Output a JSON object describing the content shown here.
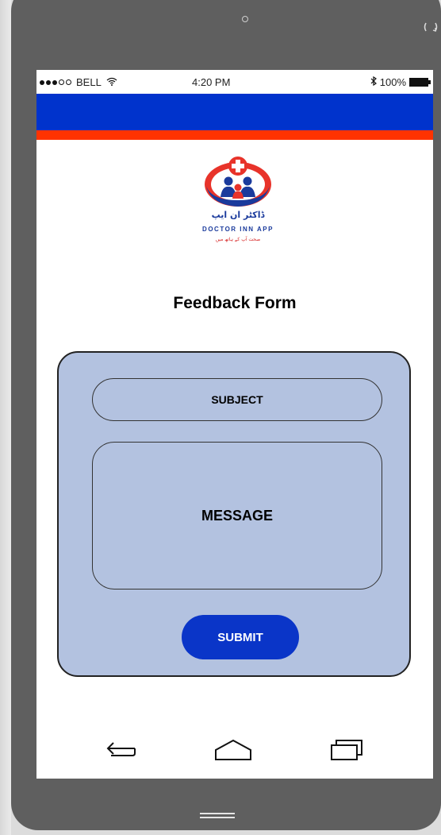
{
  "status_bar": {
    "carrier": "BELL",
    "time": "4:20 PM",
    "battery": "100%"
  },
  "logo": {
    "urdu_name": "ڈاکٹر ان ایپ",
    "brand": "DOCTOR INN APP",
    "tagline": "صحت آپ کے ہاتھ میں"
  },
  "form": {
    "title": "Feedback Form",
    "subject_label": "SUBJECT",
    "message_label": "MESSAGE",
    "submit_label": "SUBMIT"
  },
  "colors": {
    "header_blue": "#0033cc",
    "header_orange": "#ff3300",
    "card_fill": "#b3c2e0",
    "submit_blue": "#0a35c8"
  },
  "icons": {
    "status": [
      "signal-dots-icon",
      "wifi-icon",
      "bluetooth-icon",
      "battery-icon"
    ],
    "hardware": [
      "speaker-dot-icon",
      "rotate-icon"
    ],
    "navigation": [
      "back-icon",
      "home-icon",
      "recent-apps-icon",
      "home-indicator-icon"
    ]
  }
}
